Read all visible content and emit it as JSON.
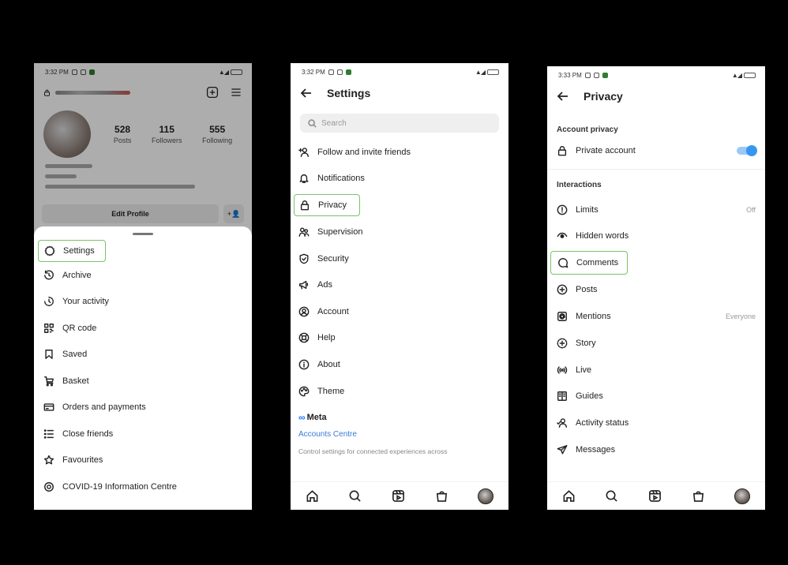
{
  "panel1": {
    "status": {
      "time": "3:32 PM"
    },
    "profile": {
      "stats": [
        {
          "value": "528",
          "label": "Posts"
        },
        {
          "value": "115",
          "label": "Followers"
        },
        {
          "value": "555",
          "label": "Following"
        }
      ],
      "edit_profile_label": "Edit Profile"
    },
    "menu": [
      {
        "label": "Settings",
        "icon": "gear-icon"
      },
      {
        "label": "Archive",
        "icon": "archive-icon"
      },
      {
        "label": "Your activity",
        "icon": "activity-icon"
      },
      {
        "label": "QR code",
        "icon": "qr-code-icon"
      },
      {
        "label": "Saved",
        "icon": "bookmark-icon"
      },
      {
        "label": "Basket",
        "icon": "basket-icon"
      },
      {
        "label": "Orders and payments",
        "icon": "card-icon"
      },
      {
        "label": "Close friends",
        "icon": "list-icon"
      },
      {
        "label": "Favourites",
        "icon": "star-icon"
      },
      {
        "label": "COVID-19 Information Centre",
        "icon": "covid-icon"
      }
    ]
  },
  "panel2": {
    "status": {
      "time": "3:32 PM"
    },
    "title": "Settings",
    "search_placeholder": "Search",
    "menu": [
      {
        "label": "Follow and invite friends",
        "icon": "add-person-icon"
      },
      {
        "label": "Notifications",
        "icon": "bell-icon"
      },
      {
        "label": "Privacy",
        "icon": "lock-icon"
      },
      {
        "label": "Supervision",
        "icon": "supervision-icon"
      },
      {
        "label": "Security",
        "icon": "shield-icon"
      },
      {
        "label": "Ads",
        "icon": "megaphone-icon"
      },
      {
        "label": "Account",
        "icon": "account-icon"
      },
      {
        "label": "Help",
        "icon": "lifebuoy-icon"
      },
      {
        "label": "About",
        "icon": "info-icon"
      },
      {
        "label": "Theme",
        "icon": "palette-icon"
      }
    ],
    "meta": {
      "logo": "Meta",
      "accounts_centre": "Accounts Centre",
      "description": "Control settings for connected experiences across"
    }
  },
  "panel3": {
    "status": {
      "time": "3:33 PM"
    },
    "title": "Privacy",
    "account_privacy_header": "Account privacy",
    "private_account_label": "Private account",
    "private_account_enabled": true,
    "interactions_header": "Interactions",
    "items": [
      {
        "label": "Limits",
        "value": "Off",
        "icon": "limits-icon"
      },
      {
        "label": "Hidden words",
        "value": "",
        "icon": "eye-icon"
      },
      {
        "label": "Comments",
        "value": "",
        "icon": "comment-icon"
      },
      {
        "label": "Posts",
        "value": "",
        "icon": "post-icon"
      },
      {
        "label": "Mentions",
        "value": "Everyone",
        "icon": "at-icon"
      },
      {
        "label": "Story",
        "value": "",
        "icon": "story-icon"
      },
      {
        "label": "Live",
        "value": "",
        "icon": "live-icon"
      },
      {
        "label": "Guides",
        "value": "",
        "icon": "guides-icon"
      },
      {
        "label": "Activity status",
        "value": "",
        "icon": "activity-status-icon"
      },
      {
        "label": "Messages",
        "value": "",
        "icon": "messages-icon"
      }
    ]
  },
  "highlight_color": "#7ac36a"
}
